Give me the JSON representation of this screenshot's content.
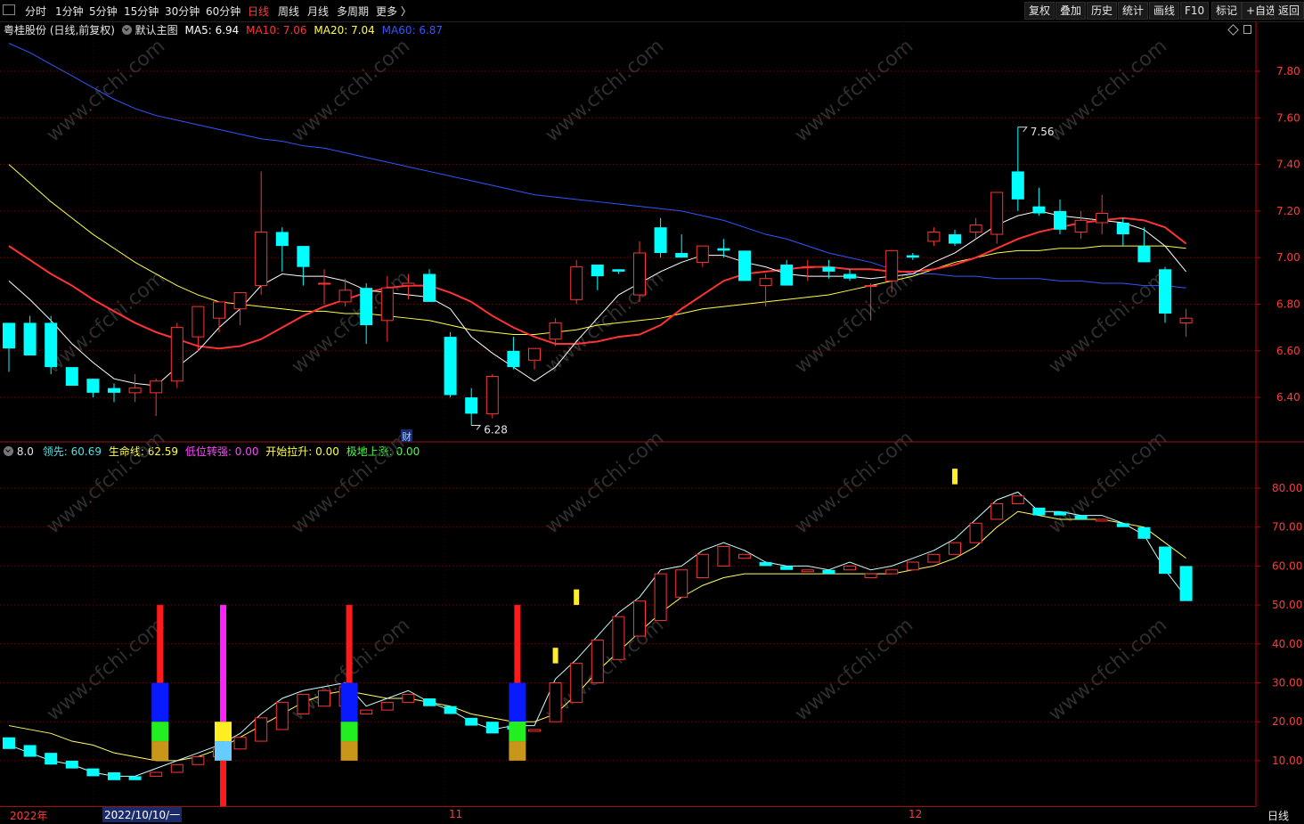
{
  "toolbar": {
    "periods": [
      "分时",
      "1分钟",
      "5分钟",
      "15分钟",
      "30分钟",
      "60分钟",
      "日线",
      "周线",
      "月线",
      "多周期",
      "更多 〉"
    ],
    "active_period": "日线",
    "right_buttons": [
      "复权",
      "叠加",
      "历史",
      "统计",
      "画线",
      "F10",
      "标记",
      "+自选",
      "返回"
    ]
  },
  "main_chart": {
    "title": "粤桂股份 (日线,前复权)",
    "template": "默认主图",
    "ma5": {
      "label": "MA5:",
      "value": "6.94",
      "color": "#ffffff"
    },
    "ma10": {
      "label": "MA10:",
      "value": "7.06",
      "color": "#ff3333"
    },
    "ma20": {
      "label": "MA20:",
      "value": "7.04",
      "color": "#ffff44"
    },
    "ma60": {
      "label": "MA60:",
      "value": "6.87",
      "color": "#3355ff"
    },
    "y_ticks": [
      "7.80",
      "7.60",
      "7.40",
      "7.20",
      "7.00",
      "6.80",
      "6.60",
      "6.40"
    ],
    "high_label": "7.56",
    "low_label": "6.28",
    "event_marker": "财",
    "watermark": "www.cfchi.com"
  },
  "indicator": {
    "name": "8.0",
    "items": [
      {
        "label": "领先:",
        "value": "60.69",
        "color": "#55e0e0"
      },
      {
        "label": "生命线:",
        "value": "62.59",
        "color": "#ffff44"
      },
      {
        "label": "低位转强:",
        "value": "0.00",
        "color": "#ff44ff"
      },
      {
        "label": "开始拉升:",
        "value": "0.00",
        "color": "#ffff44"
      },
      {
        "label": "极地上涨:",
        "value": "0.00",
        "color": "#44ff44"
      }
    ],
    "y_ticks": [
      "80.00",
      "70.00",
      "60.00",
      "50.00",
      "40.00",
      "30.00",
      "20.00",
      "10.00"
    ]
  },
  "time_axis": {
    "labels": [
      "2022年",
      "2022/10/10/一",
      "11",
      "12"
    ],
    "period_label": "日线"
  },
  "colors": {
    "up": "#ff3333",
    "down": "#00ffff",
    "grid": "#7a0000",
    "axis": "#a01010"
  },
  "chart_data": {
    "type": "candlestick",
    "candles": [
      [
        6.72,
        6.72,
        6.51,
        6.61
      ],
      [
        6.72,
        6.75,
        6.58,
        6.58
      ],
      [
        6.72,
        6.75,
        6.5,
        6.53
      ],
      [
        6.53,
        6.52,
        6.45,
        6.45
      ],
      [
        6.48,
        6.48,
        6.4,
        6.42
      ],
      [
        6.44,
        6.46,
        6.38,
        6.42
      ],
      [
        6.42,
        6.5,
        6.38,
        6.44
      ],
      [
        6.42,
        6.48,
        6.32,
        6.47
      ],
      [
        6.47,
        6.72,
        6.44,
        6.7
      ],
      [
        6.66,
        6.79,
        6.6,
        6.79
      ],
      [
        6.74,
        6.81,
        6.68,
        6.81
      ],
      [
        6.78,
        6.85,
        6.71,
        6.85
      ],
      [
        6.88,
        7.37,
        6.84,
        7.11
      ],
      [
        7.11,
        7.13,
        6.94,
        7.05
      ],
      [
        7.05,
        7.05,
        6.88,
        6.96
      ],
      [
        6.89,
        6.95,
        6.8,
        6.89
      ],
      [
        6.81,
        6.91,
        6.79,
        6.86
      ],
      [
        6.87,
        6.89,
        6.63,
        6.71
      ],
      [
        6.73,
        6.92,
        6.64,
        6.87
      ],
      [
        6.88,
        6.93,
        6.82,
        6.89
      ],
      [
        6.93,
        6.95,
        6.81,
        6.81
      ],
      [
        6.66,
        6.68,
        6.4,
        6.41
      ],
      [
        6.4,
        6.44,
        6.28,
        6.33
      ],
      [
        6.33,
        6.5,
        6.31,
        6.49
      ],
      [
        6.6,
        6.66,
        6.52,
        6.53
      ],
      [
        6.56,
        6.61,
        6.52,
        6.61
      ],
      [
        6.65,
        6.74,
        6.62,
        6.72
      ],
      [
        6.82,
        6.99,
        6.8,
        6.96
      ],
      [
        6.97,
        6.97,
        6.86,
        6.92
      ],
      [
        6.95,
        6.95,
        6.93,
        6.94
      ],
      [
        6.84,
        7.07,
        6.81,
        7.02
      ],
      [
        7.13,
        7.17,
        7.0,
        7.02
      ],
      [
        7.02,
        7.1,
        7.0,
        7.0
      ],
      [
        6.98,
        7.05,
        6.96,
        7.05
      ],
      [
        7.04,
        7.08,
        7.0,
        7.03
      ],
      [
        7.03,
        7.03,
        6.9,
        6.9
      ],
      [
        6.88,
        6.93,
        6.79,
        6.91
      ],
      [
        6.97,
        6.99,
        6.88,
        6.88
      ],
      [
        6.96,
        6.99,
        6.9,
        6.96
      ],
      [
        6.96,
        6.99,
        6.91,
        6.94
      ],
      [
        6.93,
        6.95,
        6.9,
        6.91
      ],
      [
        6.88,
        6.89,
        6.73,
        6.88
      ],
      [
        6.9,
        7.03,
        6.85,
        7.03
      ],
      [
        7.01,
        7.02,
        6.99,
        7.0
      ],
      [
        7.07,
        7.13,
        7.05,
        7.11
      ],
      [
        7.1,
        7.12,
        7.05,
        7.06
      ],
      [
        7.11,
        7.17,
        7.08,
        7.14
      ],
      [
        7.1,
        7.28,
        7.06,
        7.28
      ],
      [
        7.37,
        7.56,
        7.2,
        7.25
      ],
      [
        7.22,
        7.3,
        7.18,
        7.19
      ],
      [
        7.2,
        7.25,
        7.1,
        7.12
      ],
      [
        7.11,
        7.2,
        7.08,
        7.16
      ],
      [
        7.15,
        7.27,
        7.1,
        7.19
      ],
      [
        7.15,
        7.17,
        7.05,
        7.1
      ],
      [
        7.05,
        7.13,
        6.98,
        6.98
      ],
      [
        6.95,
        6.96,
        6.72,
        6.76
      ],
      [
        6.72,
        6.78,
        6.66,
        6.74
      ]
    ],
    "ma5": [
      6.9,
      6.82,
      6.73,
      6.63,
      6.55,
      6.48,
      6.46,
      6.45,
      6.53,
      6.6,
      6.7,
      6.78,
      6.88,
      6.93,
      6.92,
      6.92,
      6.9,
      6.86,
      6.85,
      6.84,
      6.83,
      6.78,
      6.66,
      6.59,
      6.53,
      6.47,
      6.53,
      6.64,
      6.74,
      6.84,
      6.89,
      6.94,
      6.98,
      7.01,
      7.01,
      6.98,
      6.96,
      6.93,
      6.92,
      6.92,
      6.92,
      6.91,
      6.92,
      6.93,
      6.98,
      7.02,
      7.08,
      7.14,
      7.18,
      7.2,
      7.18,
      7.17,
      7.16,
      7.15,
      7.12,
      7.05,
      6.94
    ],
    "ma10": [
      7.05,
      6.99,
      6.93,
      6.88,
      6.82,
      6.77,
      6.72,
      6.68,
      6.65,
      6.62,
      6.61,
      6.62,
      6.65,
      6.7,
      6.75,
      6.79,
      6.82,
      6.85,
      6.87,
      6.88,
      6.88,
      6.85,
      6.81,
      6.75,
      6.7,
      6.66,
      6.63,
      6.63,
      6.64,
      6.66,
      6.67,
      6.71,
      6.78,
      6.84,
      6.9,
      6.93,
      6.94,
      6.95,
      6.96,
      6.96,
      6.95,
      6.95,
      6.94,
      6.94,
      6.95,
      6.97,
      7.0,
      7.04,
      7.08,
      7.11,
      7.13,
      7.15,
      7.16,
      7.17,
      7.16,
      7.13,
      7.06
    ],
    "ma20": [
      7.4,
      7.32,
      7.24,
      7.17,
      7.1,
      7.04,
      6.98,
      6.93,
      6.88,
      6.84,
      6.81,
      6.8,
      6.79,
      6.78,
      6.77,
      6.77,
      6.76,
      6.76,
      6.75,
      6.74,
      6.73,
      6.71,
      6.69,
      6.68,
      6.67,
      6.67,
      6.68,
      6.69,
      6.71,
      6.72,
      6.73,
      6.74,
      6.76,
      6.78,
      6.79,
      6.8,
      6.81,
      6.82,
      6.83,
      6.84,
      6.86,
      6.88,
      6.9,
      6.92,
      6.95,
      6.98,
      7.0,
      7.02,
      7.03,
      7.03,
      7.04,
      7.04,
      7.05,
      7.05,
      7.05,
      7.05,
      7.04
    ],
    "ma60": [
      7.92,
      7.88,
      7.83,
      7.78,
      7.73,
      7.68,
      7.64,
      7.61,
      7.59,
      7.57,
      7.55,
      7.53,
      7.51,
      7.5,
      7.48,
      7.47,
      7.45,
      7.43,
      7.41,
      7.39,
      7.37,
      7.35,
      7.33,
      7.31,
      7.29,
      7.27,
      7.26,
      7.25,
      7.24,
      7.23,
      7.22,
      7.21,
      7.2,
      7.18,
      7.16,
      7.13,
      7.1,
      7.08,
      7.05,
      7.02,
      7.0,
      6.98,
      6.95,
      6.93,
      6.93,
      6.92,
      6.92,
      6.91,
      6.91,
      6.91,
      6.9,
      6.9,
      6.89,
      6.89,
      6.88,
      6.88,
      6.87
    ],
    "indicator_bars": [
      [
        16,
        13
      ],
      [
        14,
        11
      ],
      [
        12,
        9
      ],
      [
        10,
        8
      ],
      [
        8,
        6
      ],
      [
        7,
        5
      ],
      [
        6,
        5
      ],
      [
        6,
        7
      ],
      [
        7,
        9
      ],
      [
        9,
        11
      ],
      [
        11,
        13
      ],
      [
        13,
        16
      ],
      [
        15,
        21
      ],
      [
        18,
        25
      ],
      [
        22,
        27
      ],
      [
        24,
        28
      ],
      [
        24,
        29
      ],
      [
        22,
        23
      ],
      [
        23,
        25
      ],
      [
        25,
        27
      ],
      [
        26,
        24
      ],
      [
        24,
        22
      ],
      [
        21,
        19
      ],
      [
        20,
        17
      ],
      [
        19,
        18
      ],
      [
        18,
        18
      ],
      [
        20,
        30
      ],
      [
        25,
        35
      ],
      [
        30,
        41
      ],
      [
        36,
        47
      ],
      [
        42,
        51
      ],
      [
        46,
        58
      ],
      [
        52,
        59
      ],
      [
        57,
        63
      ],
      [
        60,
        65
      ],
      [
        62,
        63
      ],
      [
        61,
        60
      ],
      [
        60,
        59
      ],
      [
        59,
        59
      ],
      [
        59,
        58
      ],
      [
        59,
        60
      ],
      [
        57,
        58
      ],
      [
        58,
        59
      ],
      [
        59,
        61
      ],
      [
        61,
        63
      ],
      [
        63,
        66
      ],
      [
        66,
        71
      ],
      [
        72,
        76
      ],
      [
        76,
        78
      ],
      [
        75,
        73
      ],
      [
        74,
        73
      ],
      [
        73,
        72
      ],
      [
        72,
        72
      ],
      [
        71,
        70
      ],
      [
        70,
        67
      ],
      [
        65,
        58
      ],
      [
        60,
        51
      ]
    ],
    "indicator_line": [
      19,
      18,
      17,
      15,
      14,
      12,
      11,
      10,
      10,
      11,
      13,
      16,
      19,
      22,
      25,
      27,
      28,
      27,
      26,
      26,
      25,
      24,
      22,
      21,
      20,
      20,
      22,
      27,
      33,
      38,
      43,
      48,
      52,
      55,
      57,
      58,
      58,
      58,
      58,
      58,
      58,
      58,
      58,
      59,
      60,
      62,
      65,
      70,
      74,
      73,
      72,
      72,
      72,
      71,
      70,
      66,
      62
    ],
    "signals": [
      {
        "index": 7,
        "kind": "stack"
      },
      {
        "index": 10,
        "kind": "magenta"
      },
      {
        "index": 16,
        "kind": "stack"
      },
      {
        "index": 24,
        "kind": "stack"
      }
    ],
    "yellow_markers": [
      {
        "index": 26,
        "value": 37
      },
      {
        "index": 27,
        "value": 52
      },
      {
        "index": 45,
        "value": 83
      }
    ]
  }
}
